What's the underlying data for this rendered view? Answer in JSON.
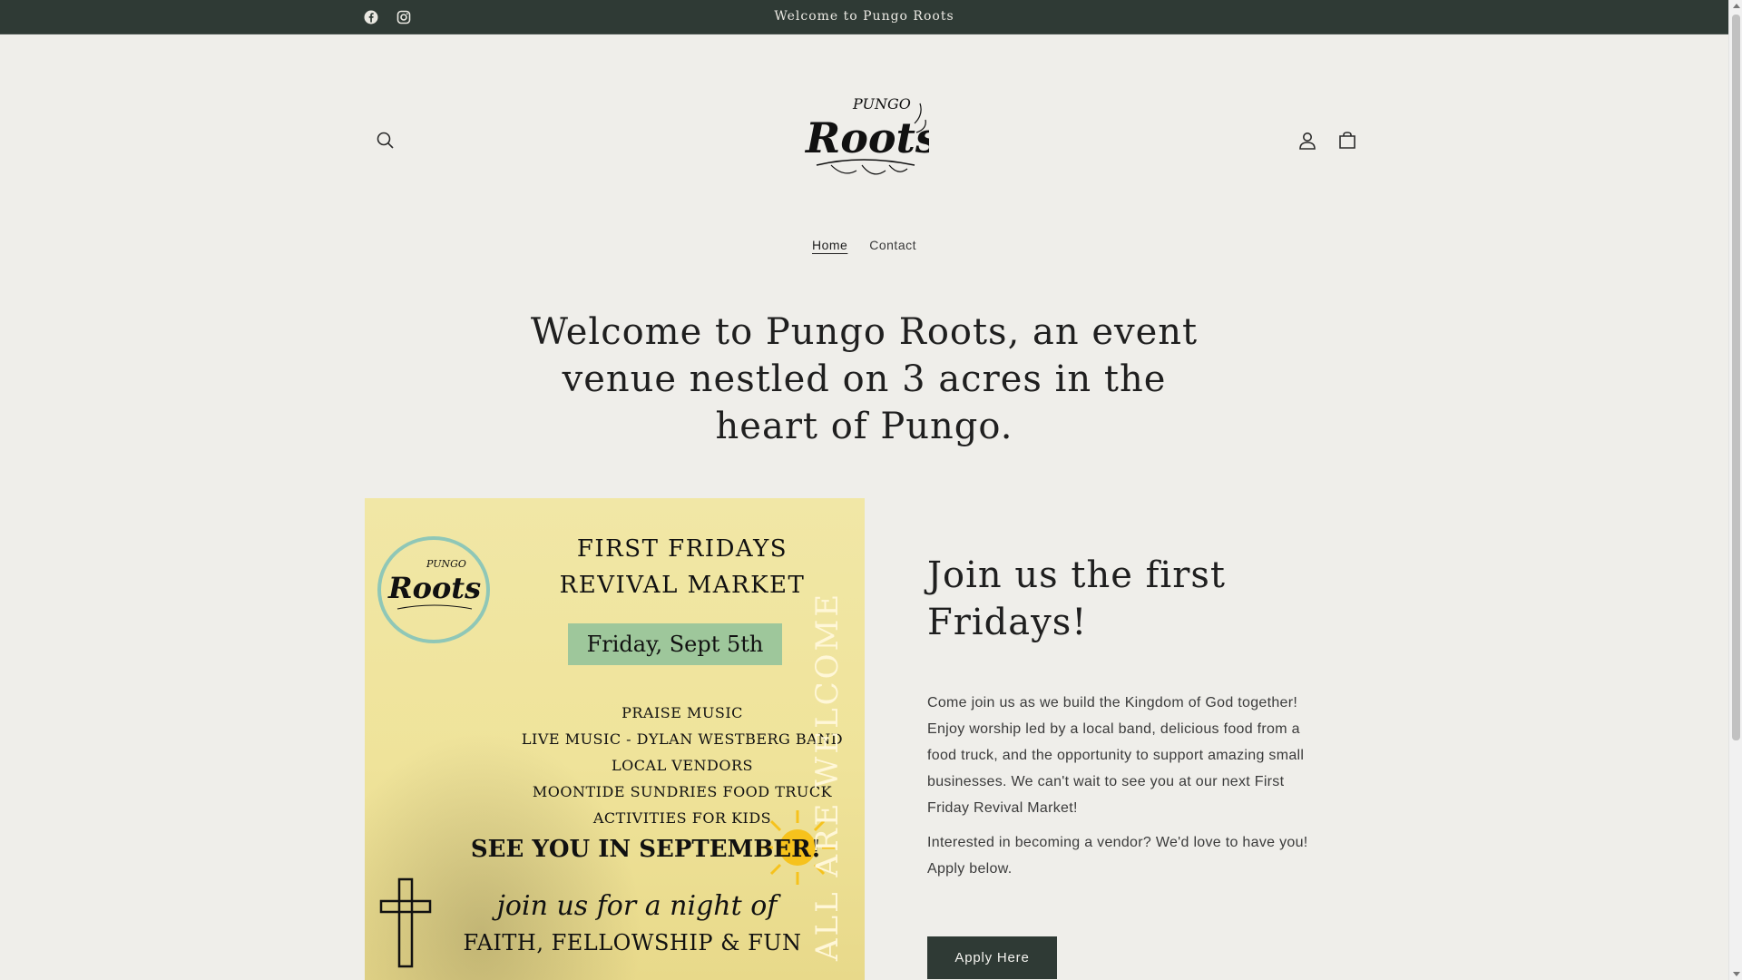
{
  "announcement": {
    "message": "Welcome to Pungo Roots",
    "social": [
      {
        "name": "facebook-icon"
      },
      {
        "name": "instagram-icon"
      }
    ]
  },
  "header": {
    "logo_text_top": "PUNGO",
    "logo_text_main": "Roots",
    "icons": [
      "search-icon",
      "account-icon",
      "cart-icon"
    ]
  },
  "nav": {
    "items": [
      {
        "label": "Home",
        "active": true
      },
      {
        "label": "Contact",
        "active": false
      }
    ]
  },
  "hero": {
    "title": "Welcome to Pungo Roots, an event venue nestled on 3 acres in the heart of Pungo."
  },
  "poster": {
    "logo_top": "PUNGO",
    "logo_main": "Roots",
    "title_line1": "FIRST FRIDAYS",
    "title_line2": "REVIVAL MARKET",
    "date": "Friday, Sept 5th",
    "list": [
      "PRAISE MUSIC",
      "LIVE MUSIC - DYLAN WESTBERG BAND",
      "LOCAL VENDORS",
      "MOONTIDE SUNDRIES FOOD TRUCK",
      "ACTIVITIES FOR KIDS"
    ],
    "see_you": "SEE YOU IN SEPTEMBER!",
    "join_line": "join us for a night of",
    "faith_line": "FAITH, FELLOWSHIP & FUN",
    "vertical": "ALL ARE WELCOME"
  },
  "feature": {
    "title": "Join us the first Fridays!",
    "paragraph1": "Come join us as we build the Kingdom of God together! Enjoy worship led by a local band, delicious food from a food truck, and the opportunity to support amazing small businesses. We can't wait to see you at our next First Friday Revival Market!",
    "paragraph2": "Interested in becoming a vendor? We'd love to have you! Apply below.",
    "button_label": "Apply Here"
  },
  "colors": {
    "background": "#efeeea",
    "dark": "#2f3a35",
    "poster_yellow": "#efe39a",
    "date_green": "#9ec79b",
    "logo_ring": "#8fc7b7"
  }
}
